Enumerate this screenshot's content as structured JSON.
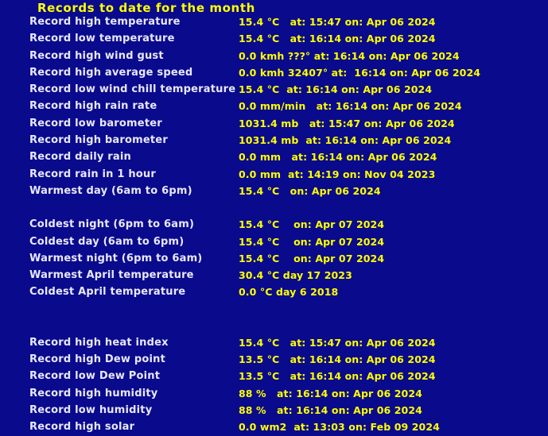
{
  "page": {
    "title": "Records to date for the month",
    "background_color": "#0a0a8c",
    "title_color": "#ffff00",
    "label_color": "#e8e8ff",
    "value_color": "#ffff00"
  },
  "groups": [
    {
      "rows": [
        {
          "label": "Record high temperature",
          "value": "15.4 °C   at: 15:47 on: Apr 06 2024"
        },
        {
          "label": "Record low temperature",
          "value": "15.4 °C   at: 16:14 on: Apr 06 2024"
        },
        {
          "label": "Record high wind gust",
          "value": "0.0 kmh ???° at: 16:14 on: Apr 06 2024"
        },
        {
          "label": "Record high average speed",
          "value": "0.0 kmh 32407° at:  16:14 on: Apr 06 2024"
        },
        {
          "label": "Record low wind chill temperature",
          "value": "15.4 °C  at: 16:14 on: Apr 06 2024"
        },
        {
          "label": "Record high rain rate",
          "value": "0.0 mm/min   at: 16:14 on: Apr 06 2024"
        },
        {
          "label": "Record low barometer",
          "value": "1031.4 mb   at: 15:47 on: Apr 06 2024"
        },
        {
          "label": "Record high barometer",
          "value": "1031.4 mb  at: 16:14 on: Apr 06 2024"
        },
        {
          "label": "Record daily rain",
          "value": "0.0 mm   at: 16:14 on: Apr 06 2024"
        },
        {
          "label": "Record rain in 1 hour",
          "value": "0.0 mm  at: 14:19 on: Nov 04 2023"
        },
        {
          "label": "Warmest day (6am to 6pm)",
          "value": "15.4 °C   on: Apr 06 2024"
        }
      ]
    },
    {
      "rows": [
        {
          "label": "Coldest night (6pm to 6am)",
          "value": "15.4 °C    on: Apr 07 2024"
        },
        {
          "label": "Coldest day (6am to 6pm)",
          "value": "15.4 °C    on: Apr 07 2024"
        },
        {
          "label": "Warmest night (6pm to 6am)",
          "value": "15.4 °C    on: Apr 07 2024"
        },
        {
          "label": "Warmest April temperature",
          "value": "30.4 °C day 17 2023"
        },
        {
          "label": "Coldest April temperature",
          "value": "0.0 °C day 6 2018"
        }
      ]
    },
    {
      "rows": [
        {
          "label": "Record high heat index",
          "value": "15.4 °C   at: 15:47 on: Apr 06 2024"
        },
        {
          "label": "Record high Dew point",
          "value": "13.5 °C   at: 16:14 on: Apr 06 2024"
        },
        {
          "label": "Record low Dew Point",
          "value": "13.5 °C   at: 16:14 on: Apr 06 2024"
        },
        {
          "label": "Record high humidity",
          "value": "88 %   at: 16:14 on: Apr 06 2024"
        },
        {
          "label": "Record low humidity",
          "value": "88 %   at: 16:14 on: Apr 06 2024"
        },
        {
          "label": "Record high solar",
          "value": "0.0 wm2  at: 13:03 on: Feb 09 2024"
        }
      ]
    }
  ]
}
